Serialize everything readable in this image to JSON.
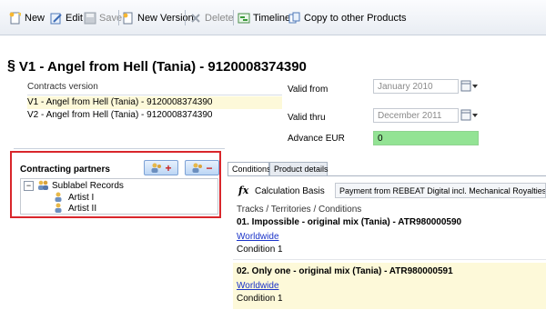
{
  "toolbar": {
    "new_label": "New",
    "edit_label": "Edit",
    "save_label": "Save",
    "new_version_label": "New Version",
    "delete_label": "Delete",
    "timeline_label": "Timeline",
    "copy_label": "Copy to other Products"
  },
  "title": "V1 - Angel from Hell (Tania) - 9120008374390",
  "contracts_version": {
    "header": "Contracts version",
    "rows": [
      "V1 - Angel from Hell (Tania) - 9120008374390",
      "V2 - Angel from Hell (Tania) - 9120008374390"
    ]
  },
  "fields": {
    "valid_from_label": "Valid from",
    "valid_from_value": "January 2010",
    "valid_thru_label": "Valid thru",
    "valid_thru_value": "December 2011",
    "advance_label": "Advance EUR",
    "advance_value": "0"
  },
  "contracting_partners": {
    "label": "Contracting partners",
    "add_sign": "+",
    "remove_sign": "−",
    "tree": {
      "root": "Sublabel Records",
      "toggle": "−",
      "children": [
        "Artist I",
        "Artist II"
      ]
    }
  },
  "tabs": [
    "Conditions",
    "Product details"
  ],
  "calculation": {
    "icon_glyph": "fx",
    "label": "Calculation Basis",
    "value": "Payment from REBEAT Digital incl. Mechanical Royalties"
  },
  "tracks_header": "Tracks / Territories / Conditions",
  "tracks": [
    {
      "title": "01. Impossible - original mix (Tania) - ATR980000590",
      "territory": "Worldwide",
      "condition": "Condition 1"
    },
    {
      "title": "02. Only one - original mix (Tania) - ATR980000591",
      "territory": "Worldwide",
      "condition": "Condition 1"
    }
  ],
  "colors": {
    "accent_red": "#d9262b",
    "advance_green": "#93e394",
    "highlight_yellow": "#fdf9d9",
    "link_blue": "#1a33c8"
  }
}
